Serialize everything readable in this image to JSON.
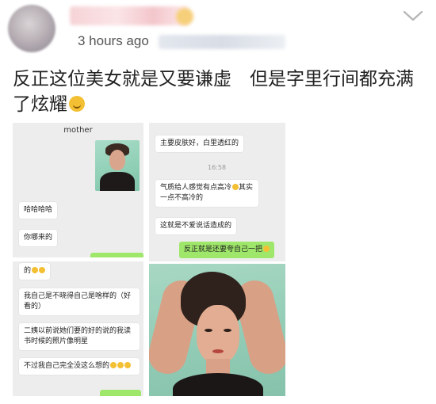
{
  "post": {
    "timestamp": "3 hours ago",
    "text": "反正这位美女就是又要谦虚　但是字里行间都充满了炫耀"
  },
  "chat1": {
    "title": "mother",
    "messages": [
      "哈哈哈哈",
      "你哪来的"
    ]
  },
  "chat2": {
    "messages": [
      "主要皮肤好，白里透红的",
      "气质给人感觉有点高冷",
      "其实一点不高冷的",
      "这就是不爱说话造成的",
      "反正就是还要夸自己一把"
    ],
    "time": "16:58"
  },
  "chat3": {
    "messages": [
      "的",
      "我自己是不晓得自己是啥样的（好看的）",
      "二姨以前说她们要的好的说的我读书时候的照片像明星",
      "不过我自己完全没这么想的"
    ]
  },
  "icons": {
    "menu": "chevron-down-icon",
    "emoji": "upside-down-face-emoji"
  }
}
